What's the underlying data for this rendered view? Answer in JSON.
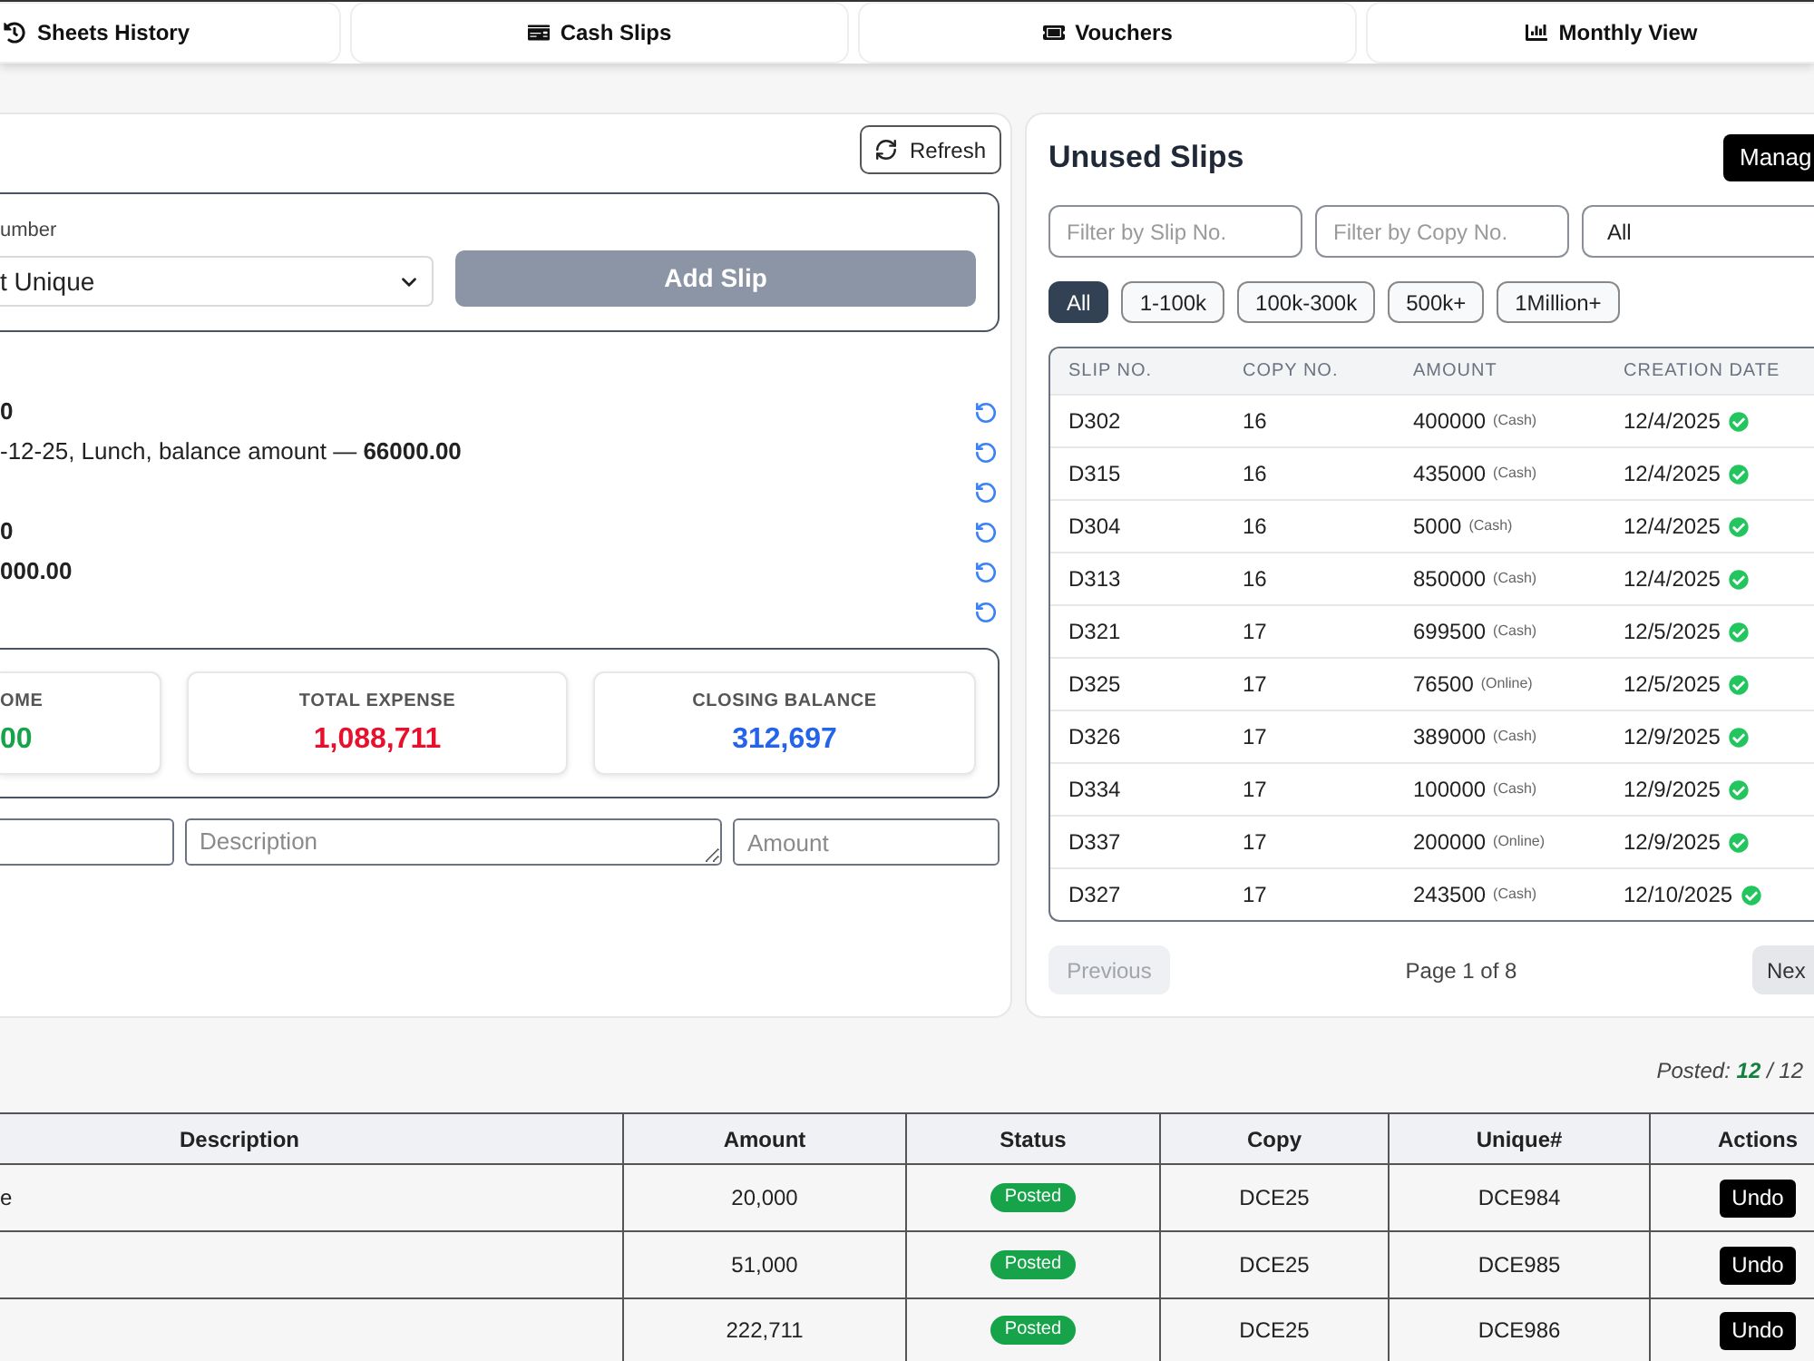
{
  "tabs": [
    {
      "label": "Sheets History",
      "selected": false
    },
    {
      "label": "Cash Slips",
      "selected": false
    },
    {
      "label": "Vouchers",
      "selected": false
    },
    {
      "label": "Monthly View",
      "selected": false
    }
  ],
  "left_panel": {
    "refresh_button": "Refresh",
    "slip_form": {
      "label": "umber",
      "select_value": "t Unique",
      "add_button": "Add Slip",
      "disabled": true
    },
    "entries": [
      {
        "kind": "total",
        "text": "0",
        "undo": true
      },
      {
        "kind": "line",
        "text": "-12-25, Lunch, balance amount — **66000.00**",
        "undo": true
      },
      {
        "undo": true
      },
      {
        "kind": "total",
        "text": "0",
        "undo": true
      },
      {
        "kind": "total",
        "text": "000.00",
        "undo": true
      },
      {
        "undo": true
      }
    ],
    "summary": [
      {
        "label": "OME",
        "value": "00",
        "color": "#16a34a"
      },
      {
        "label": "TOTAL EXPENSE",
        "value": "1,088,711",
        "color": "#e8112d"
      },
      {
        "label": "CLOSING BALANCE",
        "value": "312,697",
        "color": "#2563eb"
      }
    ],
    "entry_fields": [
      {
        "kind": "input"
      },
      {
        "kind": "textarea",
        "placeholder": "Description"
      },
      {
        "kind": "input",
        "placeholder": "Amount"
      }
    ]
  },
  "unused_slips": {
    "title": "Unused Slips",
    "manage_button": "Manag",
    "filters": [
      {
        "kind": "input",
        "placeholder": "Filter by Slip No."
      },
      {
        "kind": "input",
        "placeholder": "Filter by Copy No."
      },
      {
        "kind": "select",
        "value": "All"
      }
    ],
    "ranges": [
      {
        "label": "All",
        "selected": true
      },
      {
        "label": "1-100k",
        "selected": false
      },
      {
        "label": "100k-300k",
        "selected": false
      },
      {
        "label": "500k+",
        "selected": false
      },
      {
        "label": "1Million+",
        "selected": false
      }
    ],
    "columns": [
      "SLIP NO.",
      "COPY NO.",
      "AMOUNT",
      "CREATION DATE"
    ],
    "rows": [
      {
        "slip": "D302",
        "copy": "16",
        "amount": "400000",
        "mode": "(Cash)",
        "date": "12/4/2025",
        "verified": true
      },
      {
        "slip": "D315",
        "copy": "16",
        "amount": "435000",
        "mode": "(Cash)",
        "date": "12/4/2025",
        "verified": true
      },
      {
        "slip": "D304",
        "copy": "16",
        "amount": "5000",
        "mode": "(Cash)",
        "date": "12/4/2025",
        "verified": true
      },
      {
        "slip": "D313",
        "copy": "16",
        "amount": "850000",
        "mode": "(Cash)",
        "date": "12/4/2025",
        "verified": true
      },
      {
        "slip": "D321",
        "copy": "17",
        "amount": "699500",
        "mode": "(Cash)",
        "date": "12/5/2025",
        "verified": true
      },
      {
        "slip": "D325",
        "copy": "17",
        "amount": "76500",
        "mode": "(Online)",
        "date": "12/5/2025",
        "verified": true
      },
      {
        "slip": "D326",
        "copy": "17",
        "amount": "389000",
        "mode": "(Cash)",
        "date": "12/9/2025",
        "verified": true
      },
      {
        "slip": "D334",
        "copy": "17",
        "amount": "100000",
        "mode": "(Cash)",
        "date": "12/9/2025",
        "verified": true
      },
      {
        "slip": "D337",
        "copy": "17",
        "amount": "200000",
        "mode": "(Online)",
        "date": "12/9/2025",
        "verified": true
      },
      {
        "slip": "D327",
        "copy": "17",
        "amount": "243500",
        "mode": "(Cash)",
        "date": "12/10/2025",
        "verified": true
      }
    ],
    "pagination": {
      "previous": "Previous",
      "previous_disabled": true,
      "page": "Page 1 of 8",
      "next": "Nex"
    }
  },
  "posted": "Posted: **12** / 12",
  "sheet_table": {
    "columns": [
      "Description",
      "Amount",
      "Status",
      "Copy",
      "Unique#",
      "Actions"
    ],
    "rows": [
      {
        "description": "e",
        "amount": "20,000",
        "status": "Posted",
        "copy": "DCE25",
        "unique": "DCE984",
        "action": "Undo"
      },
      {
        "amount": "51,000",
        "status": "Posted",
        "copy": "DCE25",
        "unique": "DCE985",
        "action": "Undo"
      },
      {
        "amount": "222,711",
        "status": "Posted",
        "copy": "DCE25",
        "unique": "DCE986",
        "action": "Undo"
      }
    ]
  }
}
